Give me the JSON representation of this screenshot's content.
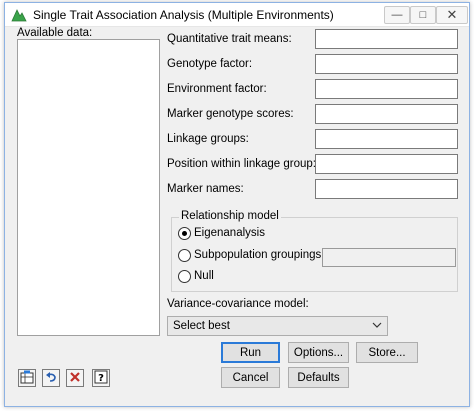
{
  "window": {
    "title": "Single Trait Association Analysis (Multiple Environments)",
    "controls": {
      "minimize": "—",
      "maximize": "□",
      "close": "✕"
    }
  },
  "available_data": {
    "label": "Available data:"
  },
  "fields": [
    {
      "label": "Quantitative trait means:",
      "value": ""
    },
    {
      "label": "Genotype factor:",
      "value": ""
    },
    {
      "label": "Environment factor:",
      "value": ""
    },
    {
      "label": "Marker genotype scores:",
      "value": ""
    },
    {
      "label": "Linkage groups:",
      "value": ""
    },
    {
      "label": "Position within linkage group:",
      "value": ""
    },
    {
      "label": "Marker names:",
      "value": ""
    }
  ],
  "relationship_model": {
    "label": "Relationship model",
    "options": [
      {
        "label": "Eigenanalysis",
        "checked": true
      },
      {
        "label": "Subpopulation groupings",
        "checked": false
      },
      {
        "label": "Null",
        "checked": false
      }
    ],
    "subpopulation_value": ""
  },
  "variance_model": {
    "label": "Variance-covariance model:",
    "selected": "Select best"
  },
  "buttons": {
    "run": "Run",
    "options": "Options...",
    "store": "Store...",
    "cancel": "Cancel",
    "defaults": "Defaults"
  },
  "toolbar_icons": [
    "spreadsheet-icon",
    "undo-icon",
    "clear-icon",
    "help-icon"
  ],
  "colors": {
    "accent": "#2a7ad8",
    "app_icon_green": "#3aa34a"
  }
}
